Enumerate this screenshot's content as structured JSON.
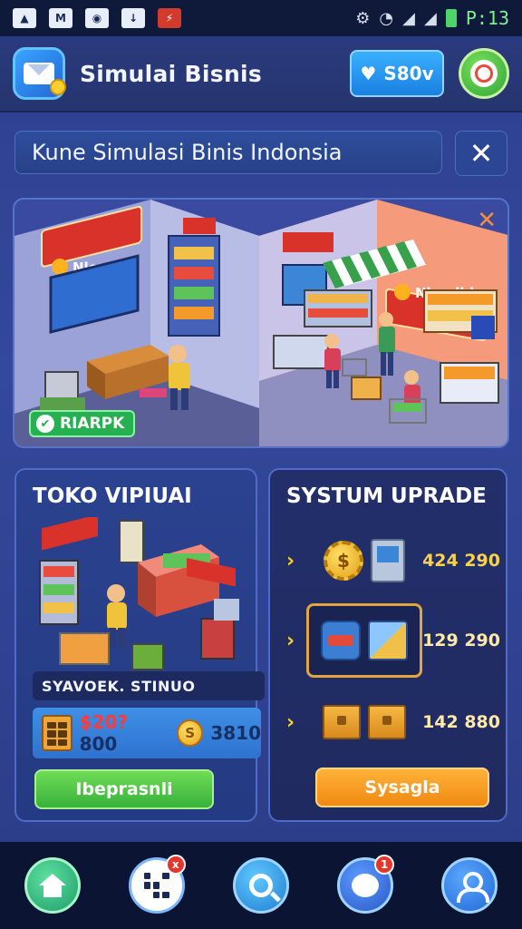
{
  "status_bar": {
    "icons": [
      "image-icon",
      "mail-icon",
      "camera-icon",
      "download-icon",
      "app-icon"
    ],
    "time": "P:13"
  },
  "header": {
    "title": "Simulai Bisnis",
    "save_label": "S80v"
  },
  "banner": {
    "text": "Kune Simulasi Binis Indonsia"
  },
  "scene": {
    "left_sign": "Nloobia",
    "right_sign": "Nbuelbl",
    "badge": "RIARPK"
  },
  "store_panel": {
    "title": "TOKO VIPIUAI",
    "store_label": "SYAVOEK. STINUO",
    "money_red": "$20?",
    "money_rest": "800",
    "coins": "3810",
    "action_label": "Ibeprasnli"
  },
  "upgrade_panel": {
    "title": "SYSTUM UPRADE",
    "items": [
      {
        "icons": [
          "coin-gear-icon",
          "atm-icon"
        ],
        "value": "424 290"
      },
      {
        "icons": [
          "can-icon",
          "cube-icon"
        ],
        "value": "129 290"
      },
      {
        "icons": [
          "crate-icon",
          "crate-icon"
        ],
        "value": "142 880"
      }
    ],
    "action_label": "Sysagla"
  },
  "bottom_nav": [
    {
      "name": "home",
      "icon": "home-icon"
    },
    {
      "name": "inventory",
      "icon": "grid-icon",
      "badge": "x"
    },
    {
      "name": "search",
      "icon": "search-icon"
    },
    {
      "name": "chat",
      "icon": "chat-icon",
      "badge": "1"
    },
    {
      "name": "profile",
      "icon": "profile-icon"
    }
  ]
}
